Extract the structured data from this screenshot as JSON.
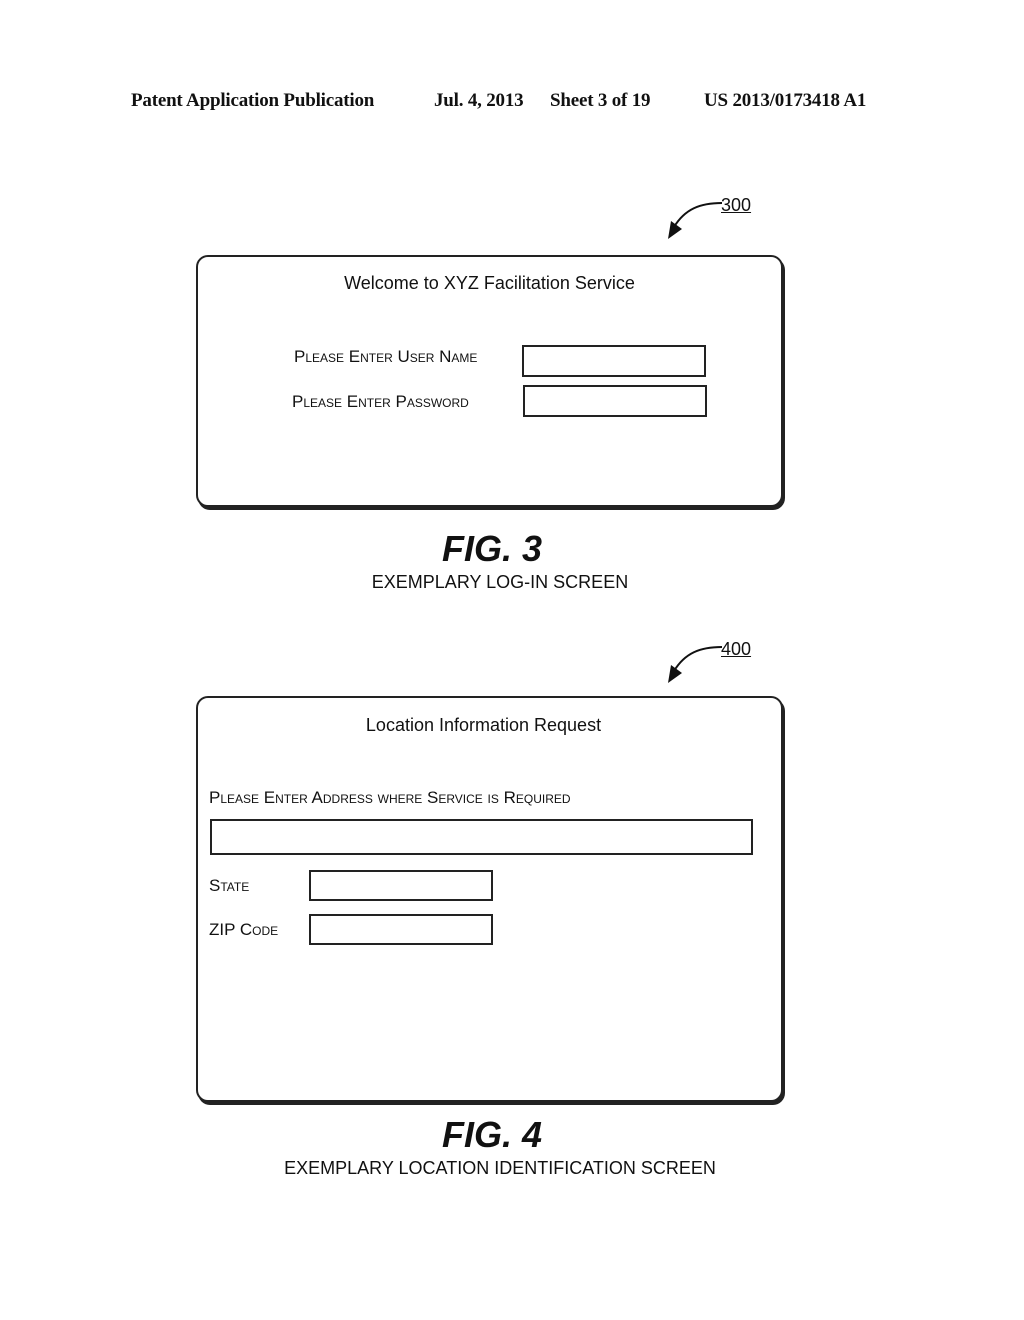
{
  "header": {
    "publication": "Patent Application Publication",
    "date": "Jul. 4, 2013",
    "sheet": "Sheet 3 of 19",
    "number": "US 2013/0173418 A1"
  },
  "fig3": {
    "ref": "300",
    "title": "Welcome to XYZ Facilitation Service",
    "username_label": "Please Enter User Name",
    "password_label": "Please Enter Password",
    "username_value": "",
    "password_value": "",
    "fig_label": "FIG. 3",
    "caption": "EXEMPLARY LOG-IN SCREEN"
  },
  "fig4": {
    "ref": "400",
    "title": "Location Information Request",
    "address_label": "Please Enter Address where Service is Required",
    "state_label": "State",
    "zip_label": "ZIP Code",
    "address_value": "",
    "state_value": "",
    "zip_value": "",
    "fig_label": "FIG. 4",
    "caption": "EXEMPLARY LOCATION IDENTIFICATION SCREEN"
  }
}
